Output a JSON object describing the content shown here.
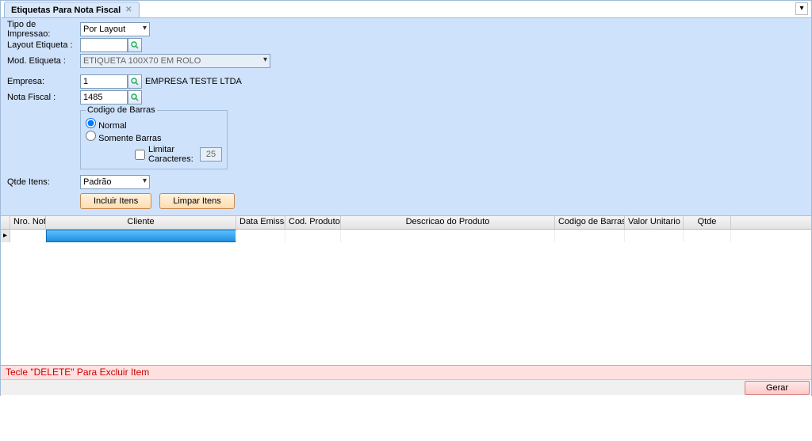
{
  "tab": {
    "title": "Etiquetas Para Nota Fiscal"
  },
  "labels": {
    "tipo_impressao": "Tipo de Impressao:",
    "layout_etiqueta": "Layout Etiqueta :",
    "mod_etiqueta": "Mod. Etiqueta :",
    "empresa": "Empresa:",
    "nota_fiscal": "Nota Fiscal :",
    "codigo_barras_legend": "Codigo de Barras",
    "opt_normal": "Normal",
    "opt_somente": "Somente Barras",
    "limitar": "Limitar Caracteres:",
    "qtde_itens": "Qtde Itens:",
    "incluir": "Incluir Itens",
    "limpar": "Limpar Itens",
    "gerar": "Gerar"
  },
  "values": {
    "tipo_impressao": "Por Layout",
    "layout_etiqueta": "",
    "mod_etiqueta": "ETIQUETA 100X70 EM ROLO",
    "empresa": "1",
    "empresa_nome": "EMPRESA TESTE LTDA",
    "nota_fiscal": "1485",
    "limitar_val": "25",
    "qtde_itens": "Padrão"
  },
  "barcode": {
    "selected": "normal",
    "limitar_checked": false
  },
  "grid": {
    "columns": {
      "nro_nota": "Nro. Nota",
      "cliente": "Cliente",
      "data_emissao": "Data Emissao",
      "cod_produto": "Cod. Produto",
      "descricao": "Descricao do Produto",
      "codigo_barras": "Codigo de Barras",
      "valor_unitario": "Valor Unitario",
      "qtde": "Qtde"
    }
  },
  "footer": {
    "hint": "Tecle \"DELETE\" Para Excluir Item"
  }
}
